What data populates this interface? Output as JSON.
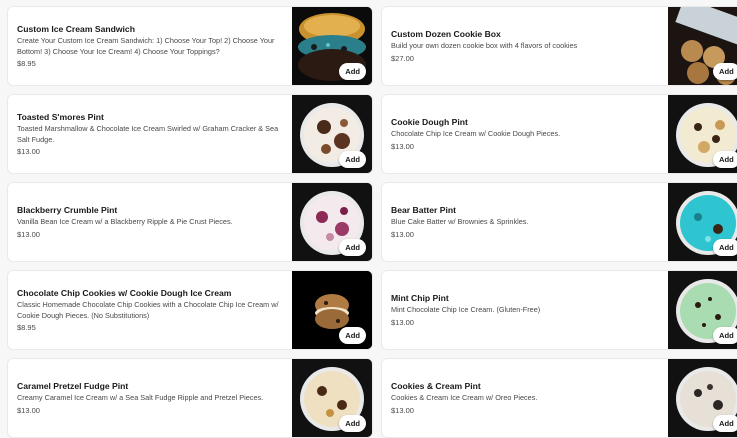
{
  "items": [
    {
      "name": "Custom Ice Cream Sandwich",
      "desc": "Create Your Custom Ice Cream Sandwich: 1) Choose Your Top! 2) Choose Your Bottom! 3) Choose Your Ice Cream! 4) Choose Your Toppings?",
      "price": "$8.95",
      "add": "Add",
      "image": "ice-cream-sandwich-photo"
    },
    {
      "name": "Custom Dozen Cookie Box",
      "desc": "Build your own dozen cookie box with 4 flavors of cookies",
      "price": "$27.00",
      "add": "Add",
      "image": "cookie-box-photo"
    },
    {
      "name": "Toasted S'mores Pint",
      "desc": "Toasted Marshmallow & Chocolate Ice Cream Swirled w/ Graham Cracker & Sea Salt Fudge.",
      "price": "$13.00",
      "add": "Add",
      "image": "smores-pint-photo"
    },
    {
      "name": "Cookie Dough Pint",
      "desc": "Chocolate Chip Ice Cream w/ Cookie Dough Pieces.",
      "price": "$13.00",
      "add": "Add",
      "image": "cookie-dough-pint-photo"
    },
    {
      "name": "Blackberry Crumble Pint",
      "desc": "Vanilla Bean Ice Cream w/ a Blackberry Ripple & Pie Crust Pieces.",
      "price": "$13.00",
      "add": "Add",
      "image": "blackberry-pint-photo"
    },
    {
      "name": "Bear Batter Pint",
      "desc": "Blue Cake Batter w/ Brownies & Sprinkles.",
      "price": "$13.00",
      "add": "Add",
      "image": "bear-batter-pint-photo"
    },
    {
      "name": "Chocolate Chip Cookies w/ Cookie Dough Ice Cream",
      "desc": "Classic Homemade Chocolate Chip Cookies with a Chocolate Chip Ice Cream w/ Cookie Dough Pieces. (No Substitutions)",
      "price": "$8.95",
      "add": "Add",
      "image": "cookie-sandwich-photo"
    },
    {
      "name": "Mint Chip Pint",
      "desc": "Mint Chocolate Chip Ice Cream. (Gluten-Free)",
      "price": "$13.00",
      "add": "Add",
      "image": "mint-chip-pint-photo"
    },
    {
      "name": "Caramel Pretzel Fudge Pint",
      "desc": "Creamy Caramel Ice Cream w/ a Sea Salt Fudge Ripple and Pretzel Pieces.",
      "price": "$13.00",
      "add": "Add",
      "image": "caramel-pretzel-pint-photo"
    },
    {
      "name": "Cookies & Cream Pint",
      "desc": "Cookies & Cream Ice Cream w/ Oreo Pieces.",
      "price": "$13.00",
      "add": "Add",
      "image": "cookies-cream-pint-photo"
    }
  ],
  "colors": {
    "card_bg": "#ffffff",
    "page_bg": "#f7f7f7",
    "title": "#191919",
    "subtext": "#494949"
  }
}
